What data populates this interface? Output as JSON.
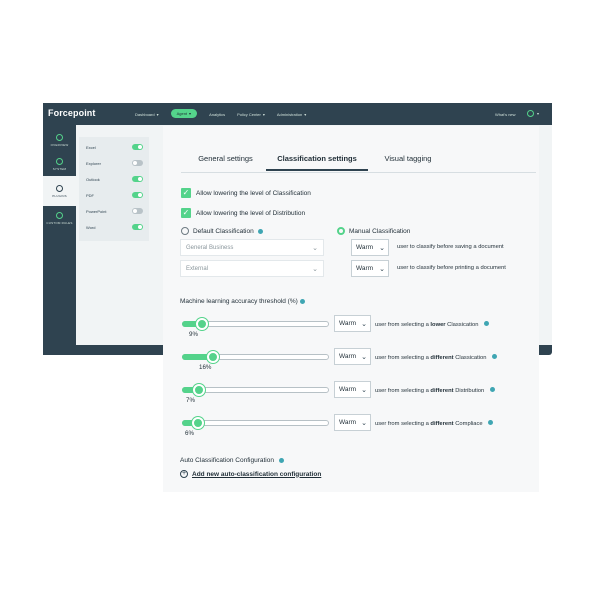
{
  "app": {
    "logo": "Forcepoint",
    "topnav": [
      {
        "label": "Dashboard",
        "caret": "▾",
        "active": false
      },
      {
        "label": "Agent",
        "caret": "▾",
        "active": true
      },
      {
        "label": "Analytics",
        "caret": "",
        "active": false
      },
      {
        "label": "Policy Center",
        "caret": "▾",
        "active": false
      },
      {
        "label": "Administration",
        "caret": "▾",
        "active": false
      }
    ],
    "whats_new": "What's new",
    "user_caret": "▾",
    "leftnav": [
      {
        "label": "OVERVIEW",
        "icon": "overview-icon"
      },
      {
        "label": "SYSTEM",
        "icon": "system-icon"
      },
      {
        "label": "PLUGINS",
        "icon": "plugin-icon"
      },
      {
        "label": "CUSTOM RULES",
        "icon": "custom-rules-icon"
      }
    ],
    "plugins": [
      {
        "label": "Excel",
        "on": true
      },
      {
        "label": "Explorer",
        "on": false
      },
      {
        "label": "Outlook",
        "on": true
      },
      {
        "label": "PDF",
        "on": true
      },
      {
        "label": "PowerPoint",
        "on": false
      },
      {
        "label": "Word",
        "on": true
      }
    ]
  },
  "settings": {
    "tabs": [
      "General settings",
      "Classification settings",
      "Visual tagging"
    ],
    "active_tab": "Classification settings",
    "checkboxes": [
      {
        "label": "Allow lowering the level of Classification",
        "checked": true
      },
      {
        "label": "Allow lowering the level of Distribution",
        "checked": true
      }
    ],
    "default_classification": {
      "label": "Default Classification",
      "selected": false
    },
    "manual_classification": {
      "label": "Manual Classification",
      "selected": true
    },
    "default_selects": [
      "General Business",
      "External"
    ],
    "manual_rows": [
      {
        "value": "Warm",
        "text": "user to classify before saving a document"
      },
      {
        "value": "Warm",
        "text": "user to classify before printing a document"
      }
    ],
    "ml_title": "Machine learning accuracy threshold (%)",
    "ml_rows": [
      {
        "value_label": "9%",
        "value": 9,
        "select": "Warm",
        "pre": "user from selecting a ",
        "bold": "lower",
        "post": " Classication"
      },
      {
        "value_label": "16%",
        "value": 16,
        "select": "Warm",
        "pre": "user from selecting a ",
        "bold": "different",
        "post": " Classication"
      },
      {
        "value_label": "7%",
        "value": 7,
        "select": "Warm",
        "pre": "user from selecting a ",
        "bold": "different",
        "post": " Distribution"
      },
      {
        "value_label": "6%",
        "value": 6,
        "select": "Warm",
        "pre": "user from selecting a ",
        "bold": "different",
        "post": " Compliace"
      }
    ],
    "auto_title": "Auto Classification Configuration",
    "add_link": "Add new auto-classification configuration",
    "chevron": "⌄"
  },
  "colors": {
    "accent": "#54d38b",
    "dark": "#2f4350",
    "info": "#3fa6b3"
  }
}
